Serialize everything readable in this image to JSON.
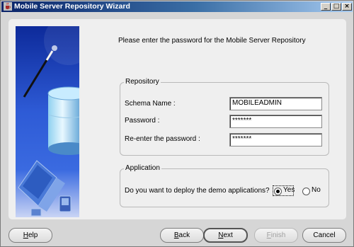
{
  "window": {
    "title": "Mobile Server Repository Wizard",
    "controls": {
      "minimize": "_",
      "maximize": "□",
      "close": "×"
    }
  },
  "page": {
    "instruction": "Please enter the password for the Mobile Server Repository"
  },
  "repository": {
    "legend": "Repository",
    "schema_label": "Schema Name :",
    "schema_value": "MOBILEADMIN",
    "password_label": "Password :",
    "password_value": "*******",
    "reenter_label": "Re-enter the password :",
    "reenter_value": "*******"
  },
  "application": {
    "legend": "Application",
    "question": "Do you want to deploy the demo applications?",
    "options": [
      {
        "label": "Yes",
        "selected": true
      },
      {
        "label": "No",
        "selected": false
      }
    ]
  },
  "buttons": {
    "help": {
      "mnemonic": "H",
      "rest": "elp"
    },
    "back": {
      "mnemonic": "B",
      "rest": "ack"
    },
    "next": {
      "mnemonic": "N",
      "rest": "ext"
    },
    "finish": {
      "mnemonic": "F",
      "rest": "inish"
    },
    "cancel": "Cancel"
  },
  "colors": {
    "titlebar_start": "#0a246a",
    "titlebar_end": "#a6caf0",
    "panel_background": "#efefef",
    "window_background": "#d6d6d6",
    "side_image_blue": "#1a3fb0"
  },
  "icons": [
    "java-coffee-cup-icon",
    "wizard-illustration-database-laptop"
  ]
}
